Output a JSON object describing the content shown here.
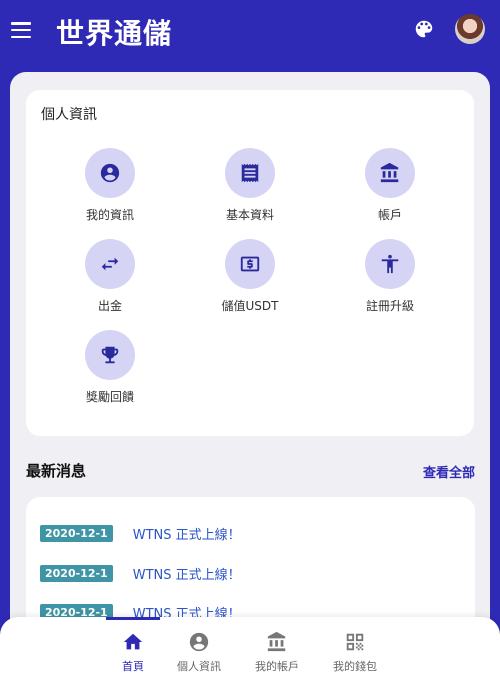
{
  "header": {
    "title": "世界通儲",
    "menu_icon": "menu-icon",
    "palette_icon": "palette-icon",
    "avatar": "user-avatar"
  },
  "profile_card": {
    "title": "個人資訊",
    "items": [
      {
        "label": "我的資訊",
        "icon": "account-circle-icon"
      },
      {
        "label": "基本資料",
        "icon": "receipt-icon"
      },
      {
        "label": "帳戶",
        "icon": "bank-icon"
      },
      {
        "label": "出金",
        "icon": "swap-arrows-icon"
      },
      {
        "label": "儲值USDT",
        "icon": "dollar-bill-icon"
      },
      {
        "label": "註冊升級",
        "icon": "person-upgrade-icon"
      },
      {
        "label": "獎勵回饋",
        "icon": "trophy-icon"
      }
    ]
  },
  "news": {
    "title": "最新消息",
    "see_all": "查看全部",
    "items": [
      {
        "date": "2020-12-1",
        "text": "WTNS 正式上線！"
      },
      {
        "date": "2020-12-1",
        "text": "WTNS 正式上線！"
      },
      {
        "date": "2020-12-1",
        "text": "WTNS 正式上線！"
      }
    ]
  },
  "bottom_nav": {
    "items": [
      {
        "label": "首頁",
        "icon": "home-icon",
        "active": true
      },
      {
        "label": "個人資訊",
        "icon": "account-circle-icon",
        "active": false
      },
      {
        "label": "我的帳戶",
        "icon": "bank-icon",
        "active": false
      },
      {
        "label": "我的錢包",
        "icon": "qr-code-icon",
        "active": false
      }
    ]
  },
  "colors": {
    "primary": "#2f2ab5",
    "icon_bg": "#d6d4f4",
    "date_badge": "#3f95a6",
    "news_link": "#2b55c9"
  }
}
